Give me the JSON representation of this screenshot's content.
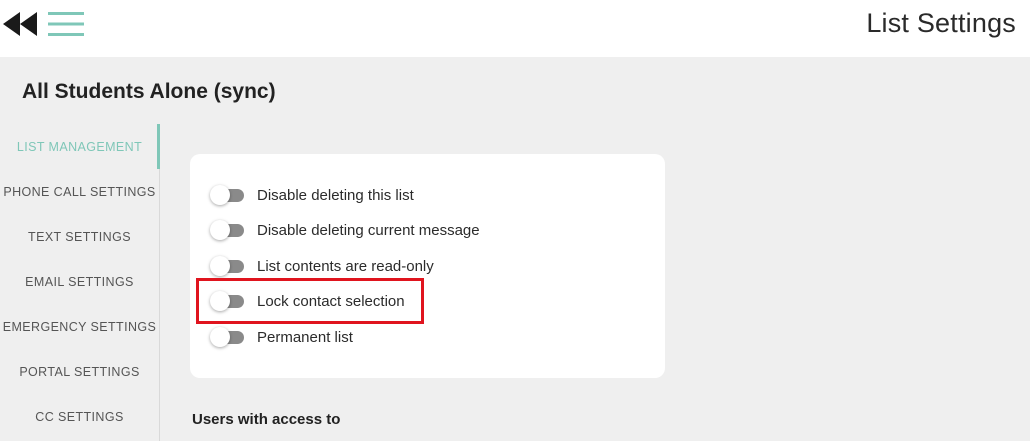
{
  "header": {
    "title": "List Settings",
    "back_icon": "double-left-arrow-icon",
    "menu_icon": "hamburger-menu-icon"
  },
  "list": {
    "name": "All Students Alone (sync)"
  },
  "sidebar": {
    "items": [
      {
        "label": "LIST MANAGEMENT",
        "active": true
      },
      {
        "label": "PHONE CALL SETTINGS",
        "active": false
      },
      {
        "label": "TEXT SETTINGS",
        "active": false
      },
      {
        "label": "EMAIL SETTINGS",
        "active": false
      },
      {
        "label": "EMERGENCY SETTINGS",
        "active": false
      },
      {
        "label": "PORTAL SETTINGS",
        "active": false
      },
      {
        "label": "CC SETTINGS",
        "active": false
      }
    ]
  },
  "settings": {
    "toggles": [
      {
        "label": "Disable deleting this list",
        "on": false
      },
      {
        "label": "Disable deleting current message",
        "on": false
      },
      {
        "label": "List contents are read-only",
        "on": false
      },
      {
        "label": "Lock contact selection",
        "on": false
      },
      {
        "label": "Permanent list",
        "on": false
      }
    ]
  },
  "access": {
    "heading": "Users with access to"
  },
  "colors": {
    "accent": "#7fc7b8",
    "highlight": "#e0141e",
    "toggle_track": "#8a8a8a",
    "background": "#efefef"
  }
}
